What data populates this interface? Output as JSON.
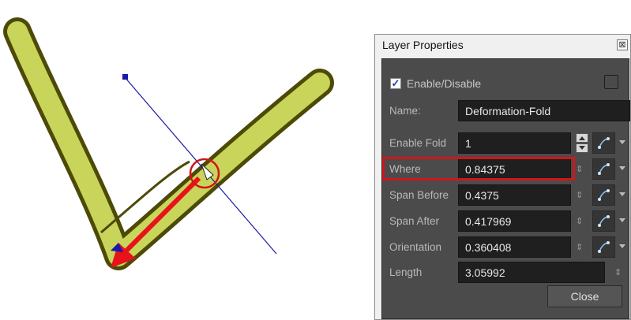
{
  "panel": {
    "title": "Layer Properties",
    "close_glyph": "⊠",
    "enable_label": "Enable/Disable",
    "enable_checked": true,
    "name_label": "Name:",
    "name_value": "Deformation-Fold",
    "rows": [
      {
        "label": "Enable Fold",
        "value": "1"
      },
      {
        "label": "Where",
        "value": "0.84375"
      },
      {
        "label": "Span Before",
        "value": "0.4375"
      },
      {
        "label": "Span After",
        "value": "0.417969"
      },
      {
        "label": "Orientation",
        "value": "0.360408"
      },
      {
        "label": "Length",
        "value": "3.05992"
      }
    ],
    "close_button": "Close",
    "spin_glyph": "⇕"
  },
  "colors": {
    "shape_fill": "#c9d55a",
    "shape_outline": "#4d4a08",
    "arrow": "#e8121b",
    "highlight": "#d0161b",
    "fold_line": "#1a1aa8",
    "panel_bg": "#4b4b4b"
  }
}
